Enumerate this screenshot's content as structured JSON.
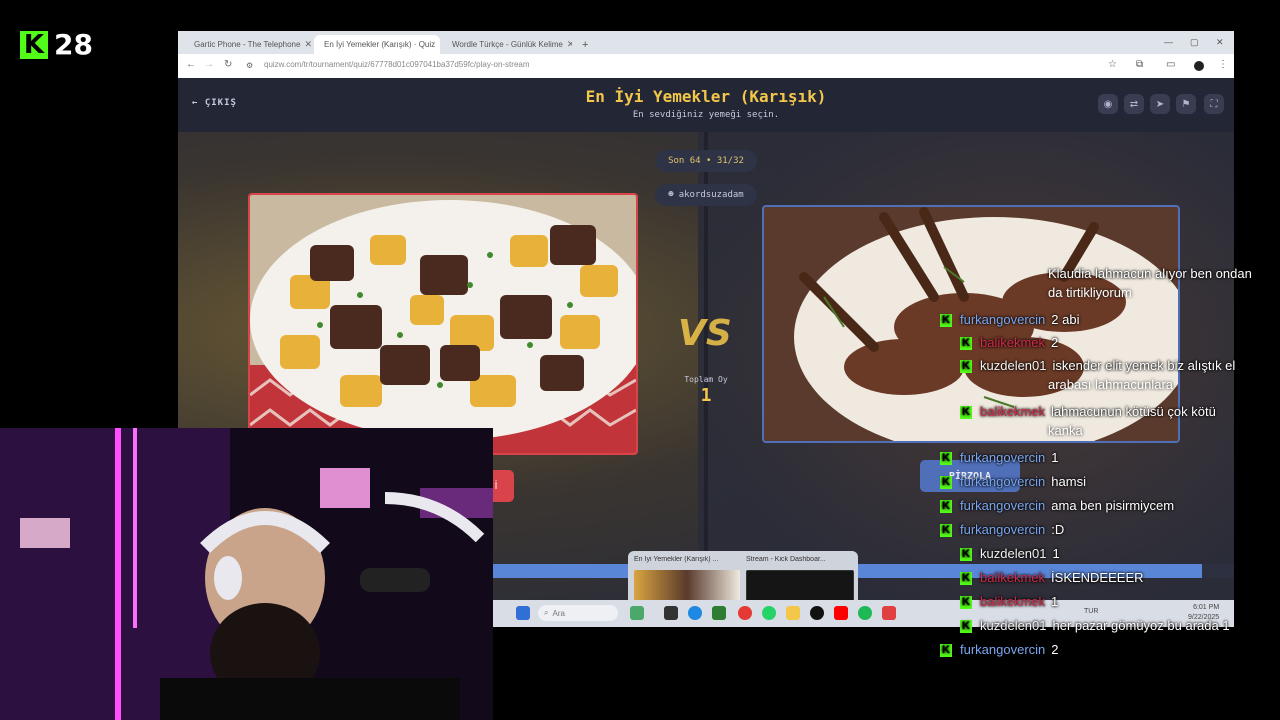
{
  "stream": {
    "logo_letter": "K",
    "counter": "28"
  },
  "browser": {
    "tabs": [
      {
        "label": "Gartic Phone - The Telephone",
        "color": "#8a5cc7"
      },
      {
        "label": "En İyi Yemekler (Karışık) · Quiz",
        "color": "#f3c74a"
      },
      {
        "label": "Wordle Türkçe - Günlük Kelime",
        "color": "#4caf50"
      }
    ],
    "new_tab": "+",
    "url": "quizw.com/tr/tournament/quiz/67778d01c097041ba37d59fc/play-on-stream"
  },
  "quiz": {
    "back_label": "ÇIKIŞ",
    "title": "En İyi Yemekler (Karışık)",
    "subtitle": "En sevdiğiniz yemeği seçin.",
    "round": "Son 64 • 31/32",
    "user": "akordsuzadam",
    "vs": "VS",
    "total_label": "Toplam Oy",
    "total_value": "1",
    "left_button": "İ",
    "right_button": "PİRZOLA",
    "progress": 0.97
  },
  "taskbar": {
    "search_placeholder": "Ara",
    "tray": "TUR",
    "time": "6:01 PM",
    "date": "9/22/2025"
  },
  "thumbnails": [
    {
      "caption": "En İyi Yemekler (Karışık) ..."
    },
    {
      "caption": "Stream - Kick Dashboar..."
    }
  ],
  "chat": {
    "messages": [
      {
        "user": "",
        "text": "Klaudia lahmacun alıyor ben ondan",
        "cont": "da tirtikliyorum",
        "color": "white",
        "badge": false
      },
      {
        "user": "furkangovercin",
        "text": "2 abi",
        "color": "blue",
        "badge": true
      },
      {
        "user": "balikekmek",
        "text": "2",
        "color": "red",
        "badge": true
      },
      {
        "user": "kuzdelen01",
        "text": "iskender elit yemek biz alıştık el",
        "cont": "arabası lahmacunlara",
        "color": "white",
        "badge": true
      },
      {
        "user": "balikekmek",
        "text": "lahmacunun kötüsü çok kötü",
        "cont": "kanka",
        "color": "red",
        "badge": true
      },
      {
        "user": "furkangovercin",
        "text": "1",
        "color": "blue",
        "badge": true
      },
      {
        "user": "furkangovercin",
        "text": "hamsi",
        "color": "blue",
        "badge": true
      },
      {
        "user": "furkangovercin",
        "text": "ama ben pisirmiycem",
        "color": "blue",
        "badge": true
      },
      {
        "user": "furkangovercin",
        "text": ":D",
        "color": "blue",
        "badge": true
      },
      {
        "user": "kuzdelen01",
        "text": "1",
        "color": "white",
        "badge": true
      },
      {
        "user": "balikekmek",
        "text": "İSKENDEEEER",
        "color": "red",
        "badge": true
      },
      {
        "user": "balikekmek",
        "text": "1",
        "color": "red",
        "badge": true
      },
      {
        "user": "kuzdelen01",
        "text": "her pazar gömüyoz bu arada 1",
        "color": "white",
        "badge": true
      },
      {
        "user": "furkangovercin",
        "text": "2",
        "color": "blue",
        "badge": true
      }
    ]
  }
}
